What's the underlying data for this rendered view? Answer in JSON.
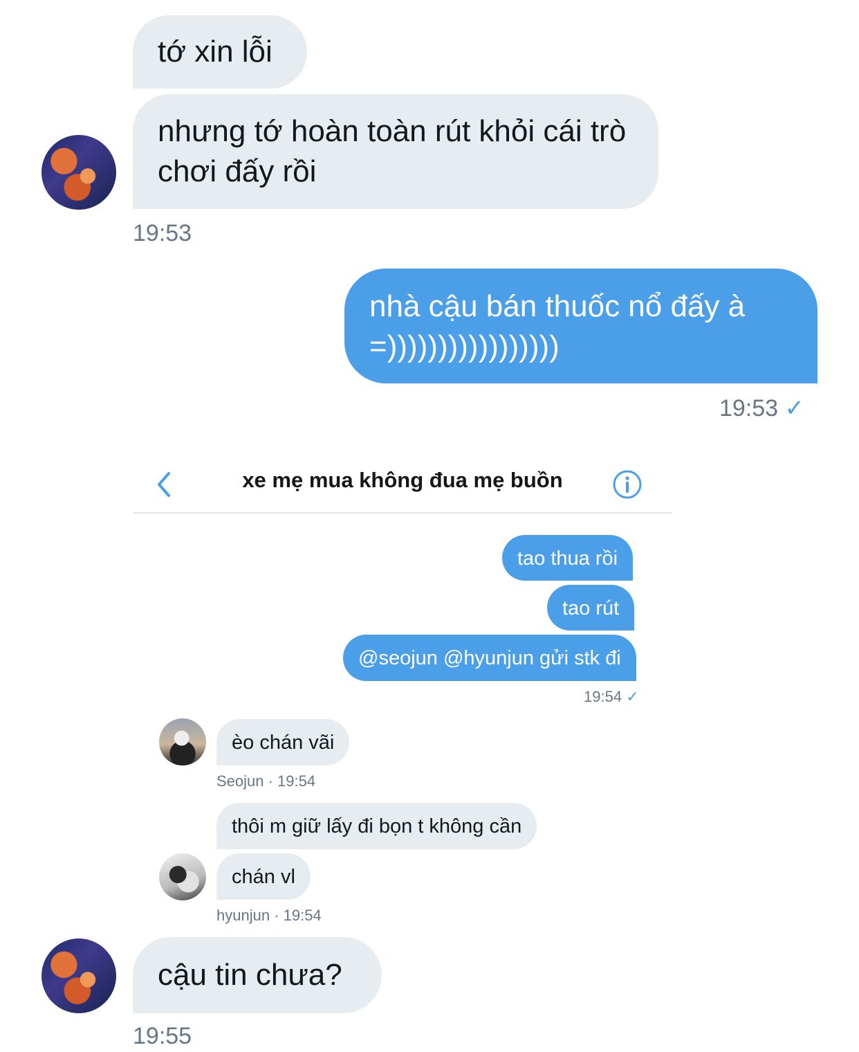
{
  "messages": [
    {
      "text": "tớ xin lỗi"
    },
    {
      "text": "nhưng tớ hoàn toàn rút khỏi cái trò chơi đấy rồi"
    },
    {
      "time": "19:53"
    },
    {
      "text": "nhà cậu bán thuốc nổ đấy à =)))))))))))))))))"
    },
    {
      "time": "19:53"
    },
    {
      "text": "cậu tin chưa?"
    },
    {
      "time": "19:55"
    }
  ],
  "sent_check": "✓",
  "inner": {
    "title": "xe mẹ mua không đua mẹ buồn",
    "back_icon": "chevron-left-icon",
    "info_icon": "info-icon",
    "outgoing": [
      "tao thua rồi",
      "tao rút",
      "@seojun @hyunjun gửi stk đi"
    ],
    "outgoing_time": "19:54",
    "seojun_msg": "èo chán vãi",
    "seojun_meta": "Seojun · 19:54",
    "hyunjun_msgs": [
      "thôi m giữ lấy đi bọn t không cần",
      "chán vl"
    ],
    "hyunjun_meta": "hyunjun · 19:54"
  },
  "colors": {
    "incoming_bubble": "#e6ecf0",
    "outgoing_bubble": "#4b9fe9",
    "timestamp": "#657786",
    "accent": "#4b9fe9"
  }
}
